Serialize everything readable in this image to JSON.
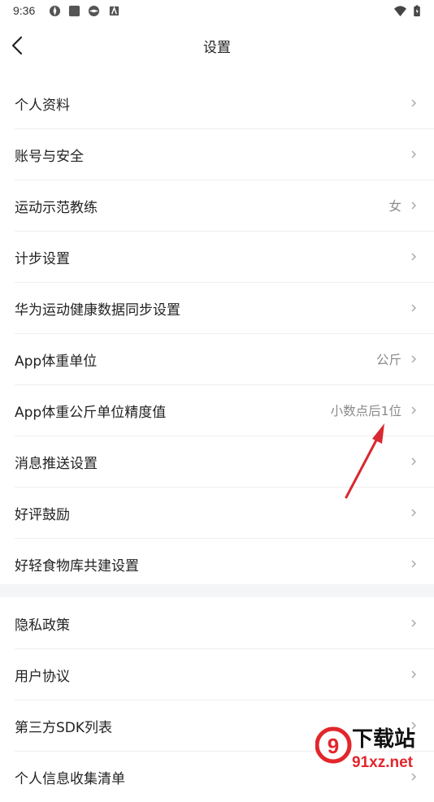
{
  "status_bar": {
    "time": "9:36",
    "icons": [
      "app-icon-1",
      "app-icon-2",
      "app-icon-3",
      "app-icon-4",
      "wifi-icon",
      "battery-icon"
    ]
  },
  "nav": {
    "title": "设置"
  },
  "group1": [
    {
      "label": "个人资料",
      "value": ""
    },
    {
      "label": "账号与安全",
      "value": ""
    },
    {
      "label": "运动示范教练",
      "value": "女"
    },
    {
      "label": "计步设置",
      "value": ""
    },
    {
      "label": "华为运动健康数据同步设置",
      "value": ""
    },
    {
      "label": "App体重单位",
      "value": "公斤"
    },
    {
      "label": "App体重公斤单位精度值",
      "value": "小数点后1位"
    },
    {
      "label": "消息推送设置",
      "value": ""
    },
    {
      "label": "好评鼓励",
      "value": ""
    },
    {
      "label": "好轻食物库共建设置",
      "value": ""
    }
  ],
  "group2": [
    {
      "label": "隐私政策",
      "value": ""
    },
    {
      "label": "用户协议",
      "value": ""
    },
    {
      "label": "第三方SDK列表",
      "value": ""
    },
    {
      "label": "个人信息收集清单",
      "value": ""
    }
  ],
  "watermark": {
    "line1": "下载站",
    "line2": "91xz.net"
  },
  "colors": {
    "annotation_arrow": "#d9282f",
    "watermark_red": "#e2262c"
  }
}
